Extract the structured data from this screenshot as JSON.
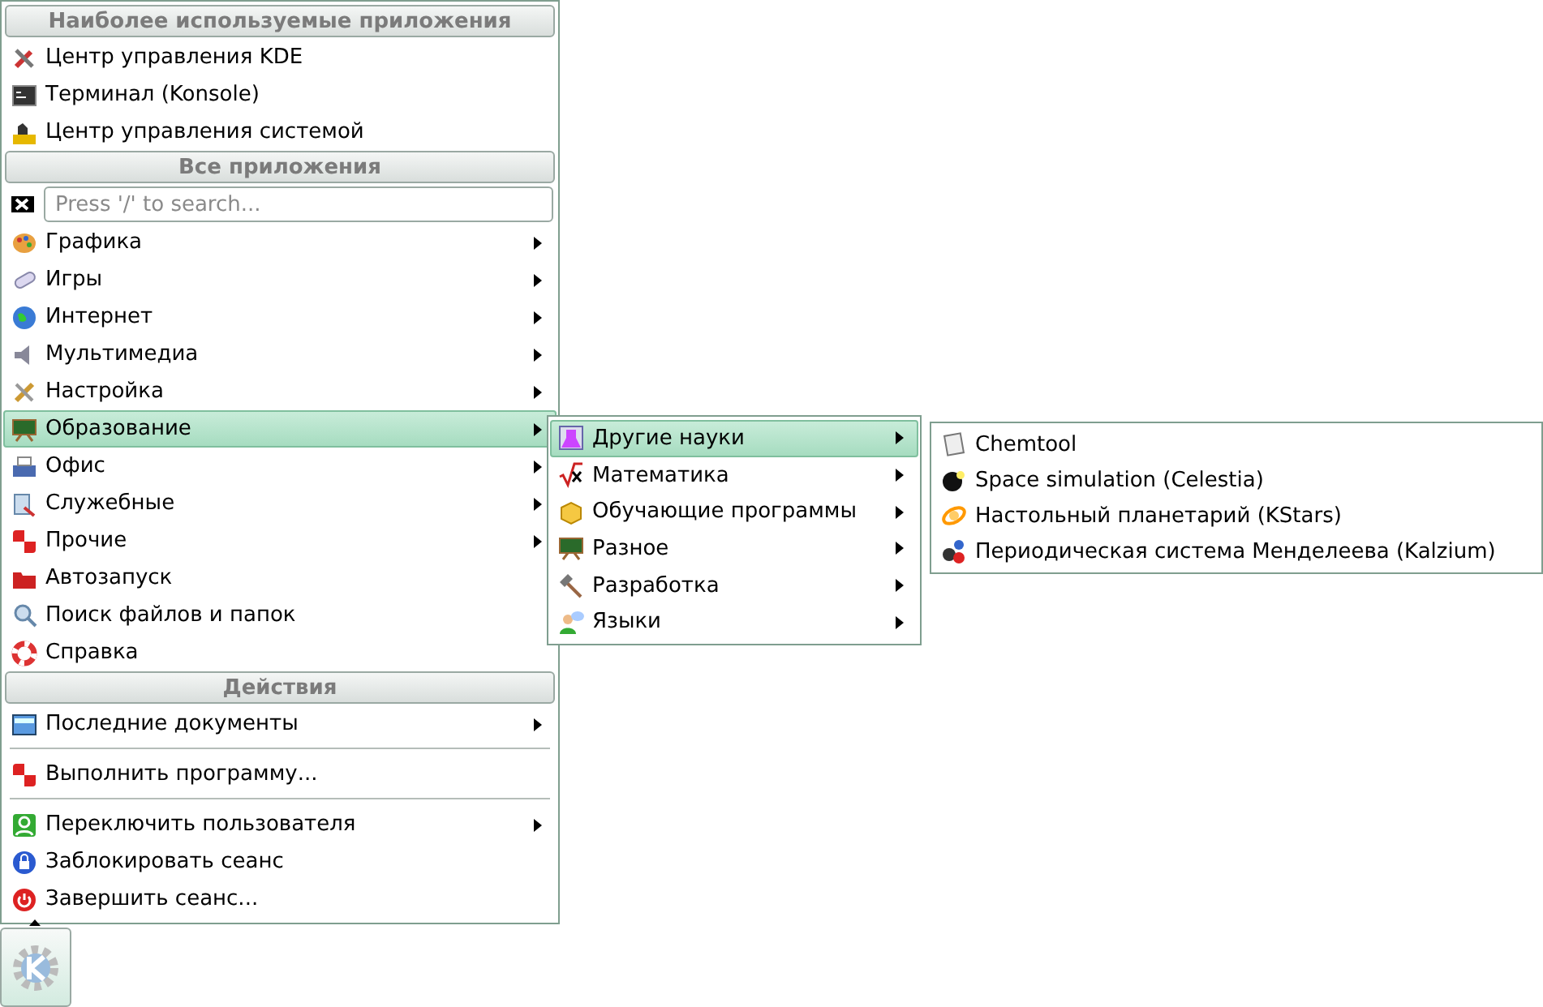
{
  "menu": {
    "sections": [
      {
        "header": "Наиболее используемые приложения",
        "items": [
          {
            "kind": "item",
            "label": "Центр управления KDE",
            "submenu": false,
            "selected": false
          },
          {
            "kind": "item",
            "label": "Терминал (Konsole)",
            "submenu": false,
            "selected": false
          },
          {
            "kind": "item",
            "label": "Центр управления системой",
            "submenu": false,
            "selected": false
          }
        ]
      },
      {
        "header": "Все приложения",
        "search": {
          "placeholder": "Press '/' to search..."
        },
        "items": [
          {
            "kind": "item",
            "label": "Графика",
            "submenu": true,
            "selected": false
          },
          {
            "kind": "item",
            "label": "Игры",
            "submenu": true,
            "selected": false
          },
          {
            "kind": "item",
            "label": "Интернет",
            "submenu": true,
            "selected": false
          },
          {
            "kind": "item",
            "label": "Мультимедиа",
            "submenu": true,
            "selected": false
          },
          {
            "kind": "item",
            "label": "Настройка",
            "submenu": true,
            "selected": false
          },
          {
            "kind": "item",
            "label": "Образование",
            "submenu": true,
            "selected": true
          },
          {
            "kind": "item",
            "label": "Офис",
            "submenu": true,
            "selected": false
          },
          {
            "kind": "item",
            "label": "Служебные",
            "submenu": true,
            "selected": false
          },
          {
            "kind": "item",
            "label": "Прочие",
            "submenu": true,
            "selected": false
          },
          {
            "kind": "item",
            "label": "Автозапуск",
            "submenu": false,
            "selected": false
          },
          {
            "kind": "item",
            "label": "Поиск файлов и папок",
            "submenu": false,
            "selected": false
          },
          {
            "kind": "item",
            "label": "Справка",
            "submenu": false,
            "selected": false
          }
        ]
      },
      {
        "header": "Действия",
        "items": [
          {
            "kind": "item",
            "label": "Последние документы",
            "submenu": true,
            "selected": false
          },
          {
            "kind": "separator"
          },
          {
            "kind": "item",
            "label": "Выполнить программу...",
            "submenu": false,
            "selected": false
          },
          {
            "kind": "separator"
          },
          {
            "kind": "item",
            "label": "Переключить пользователя",
            "submenu": true,
            "selected": false
          },
          {
            "kind": "item",
            "label": "Заблокировать сеанс",
            "submenu": false,
            "selected": false
          },
          {
            "kind": "item",
            "label": "Завершить сеанс...",
            "submenu": false,
            "selected": false
          }
        ]
      }
    ]
  },
  "education_submenu": {
    "items": [
      {
        "label": "Другие науки",
        "submenu": true,
        "selected": true
      },
      {
        "label": "Математика",
        "submenu": true,
        "selected": false
      },
      {
        "label": "Обучающие программы",
        "submenu": true,
        "selected": false
      },
      {
        "label": "Разное",
        "submenu": true,
        "selected": false
      },
      {
        "label": "Разработка",
        "submenu": true,
        "selected": false
      },
      {
        "label": "Языки",
        "submenu": true,
        "selected": false
      }
    ]
  },
  "science_submenu": {
    "items": [
      {
        "label": "Chemtool",
        "submenu": false,
        "selected": false
      },
      {
        "label": "Space simulation (Celestia)",
        "submenu": false,
        "selected": false
      },
      {
        "label": "Настольный планетарий (KStars)",
        "submenu": false,
        "selected": false
      },
      {
        "label": "Периодическая система Менделеева (Kalzium)",
        "submenu": false,
        "selected": false
      }
    ]
  }
}
